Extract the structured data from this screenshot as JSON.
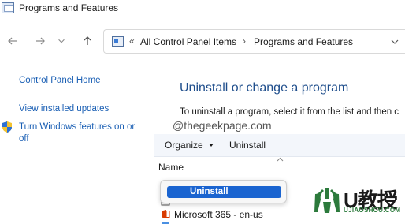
{
  "window": {
    "title": "Programs and Features"
  },
  "navigation": {
    "back_icon": "arrow-left-icon",
    "forward_icon": "arrow-right-icon",
    "dropdown_icon": "chevron-down-icon",
    "up_icon": "arrow-up-icon"
  },
  "address_bar": {
    "separator": "«",
    "crumbs": [
      "All Control Panel Items",
      "Programs and Features"
    ],
    "crumb_separator": "›"
  },
  "left_pane": {
    "links": [
      "Control Panel Home",
      "View installed updates",
      "Turn Windows features on or off"
    ]
  },
  "main": {
    "title": "Uninstall or change a program",
    "description": "To uninstall a program, select it from the list and then c",
    "watermark": "@thegeekpage.com"
  },
  "toolbar": {
    "organize_label": "Organize",
    "uninstall_label": "Uninstall"
  },
  "list": {
    "column_name": "Name",
    "rows": [
      {
        "label": "",
        "icon": "app-icon"
      },
      {
        "label": "",
        "icon": "app-icon"
      },
      {
        "label": "Microsoft 365 - en-us",
        "icon": "office-icon"
      }
    ]
  },
  "context_menu": {
    "items": [
      "Uninstall"
    ]
  },
  "logo": {
    "text": "U教授",
    "subtext": "UJIAOSHOU.COM"
  },
  "colors": {
    "link": "#1a5fb4",
    "title": "#1f4e8c",
    "menu_highlight": "#1a64d0",
    "toolbar_bg": "#f3f6fb",
    "logo_green": "#2c7a3c"
  }
}
